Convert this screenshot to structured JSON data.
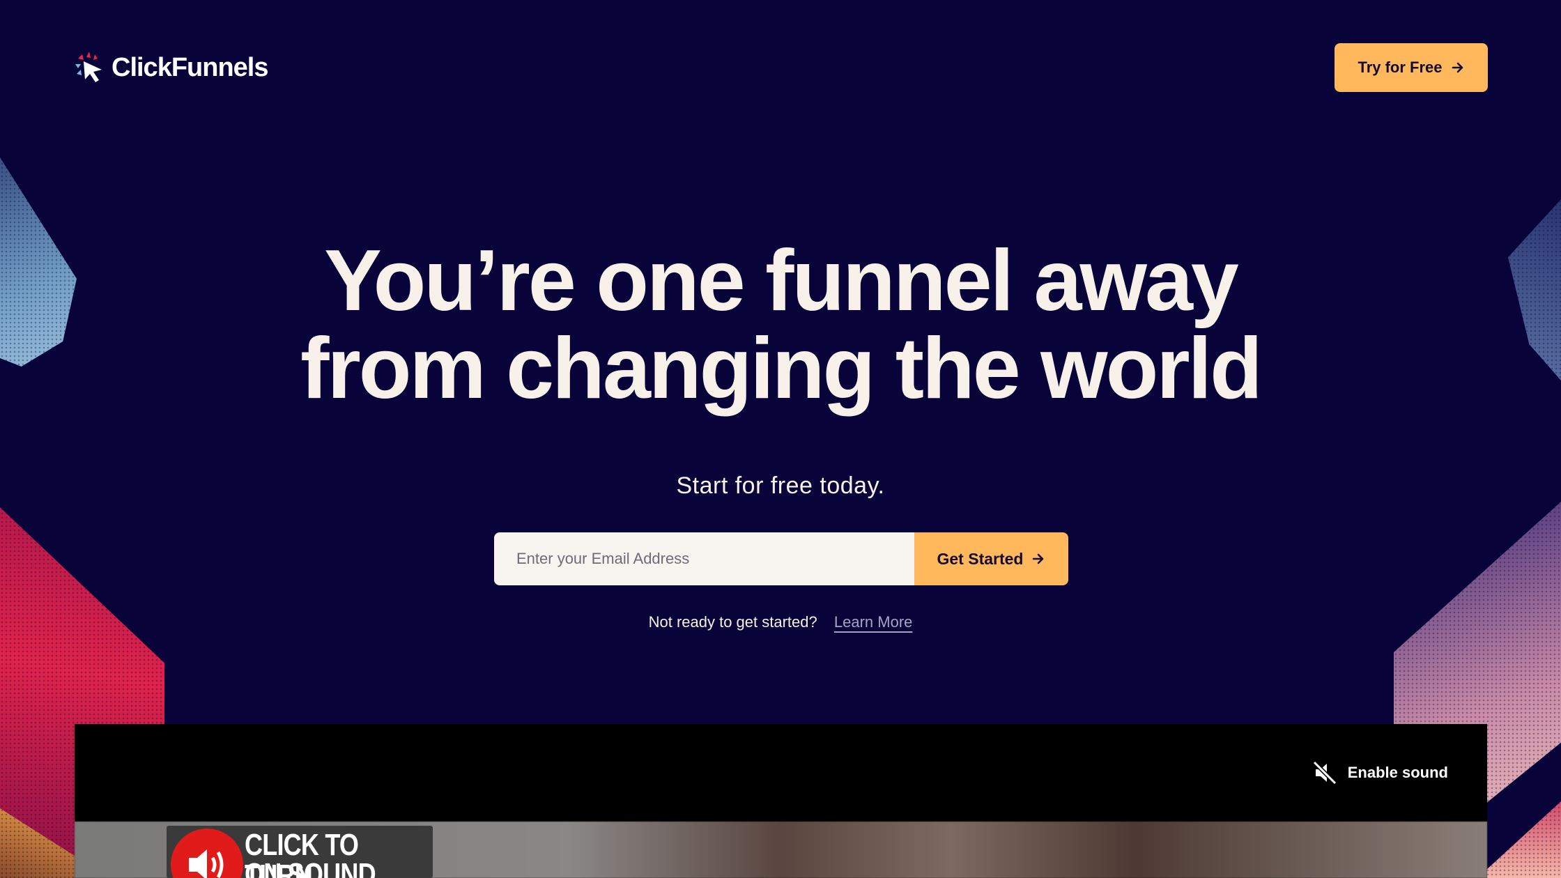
{
  "header": {
    "logo_text": "ClickFunnels",
    "try_button_label": "Try for Free"
  },
  "hero": {
    "title_line1": "You’re one funnel away",
    "title_line2": "from changing the world",
    "subtitle": "Start for free today."
  },
  "signup": {
    "email_placeholder": "Enter your Email Address",
    "email_value": "",
    "submit_label": "Get Started"
  },
  "learn": {
    "prompt": "Not ready to get started?",
    "link_label": "Learn More"
  },
  "video": {
    "sound_toggle_label": "Enable sound",
    "banner_line1": "CLICK TO TURN",
    "banner_line2": "ON SOUND"
  },
  "colors": {
    "background": "#08043a",
    "accent": "#ffb95c",
    "text": "#f7f1ea"
  },
  "icons": [
    "logo-icon",
    "arrow-right-icon",
    "muted-speaker-icon",
    "speaker-icon"
  ]
}
